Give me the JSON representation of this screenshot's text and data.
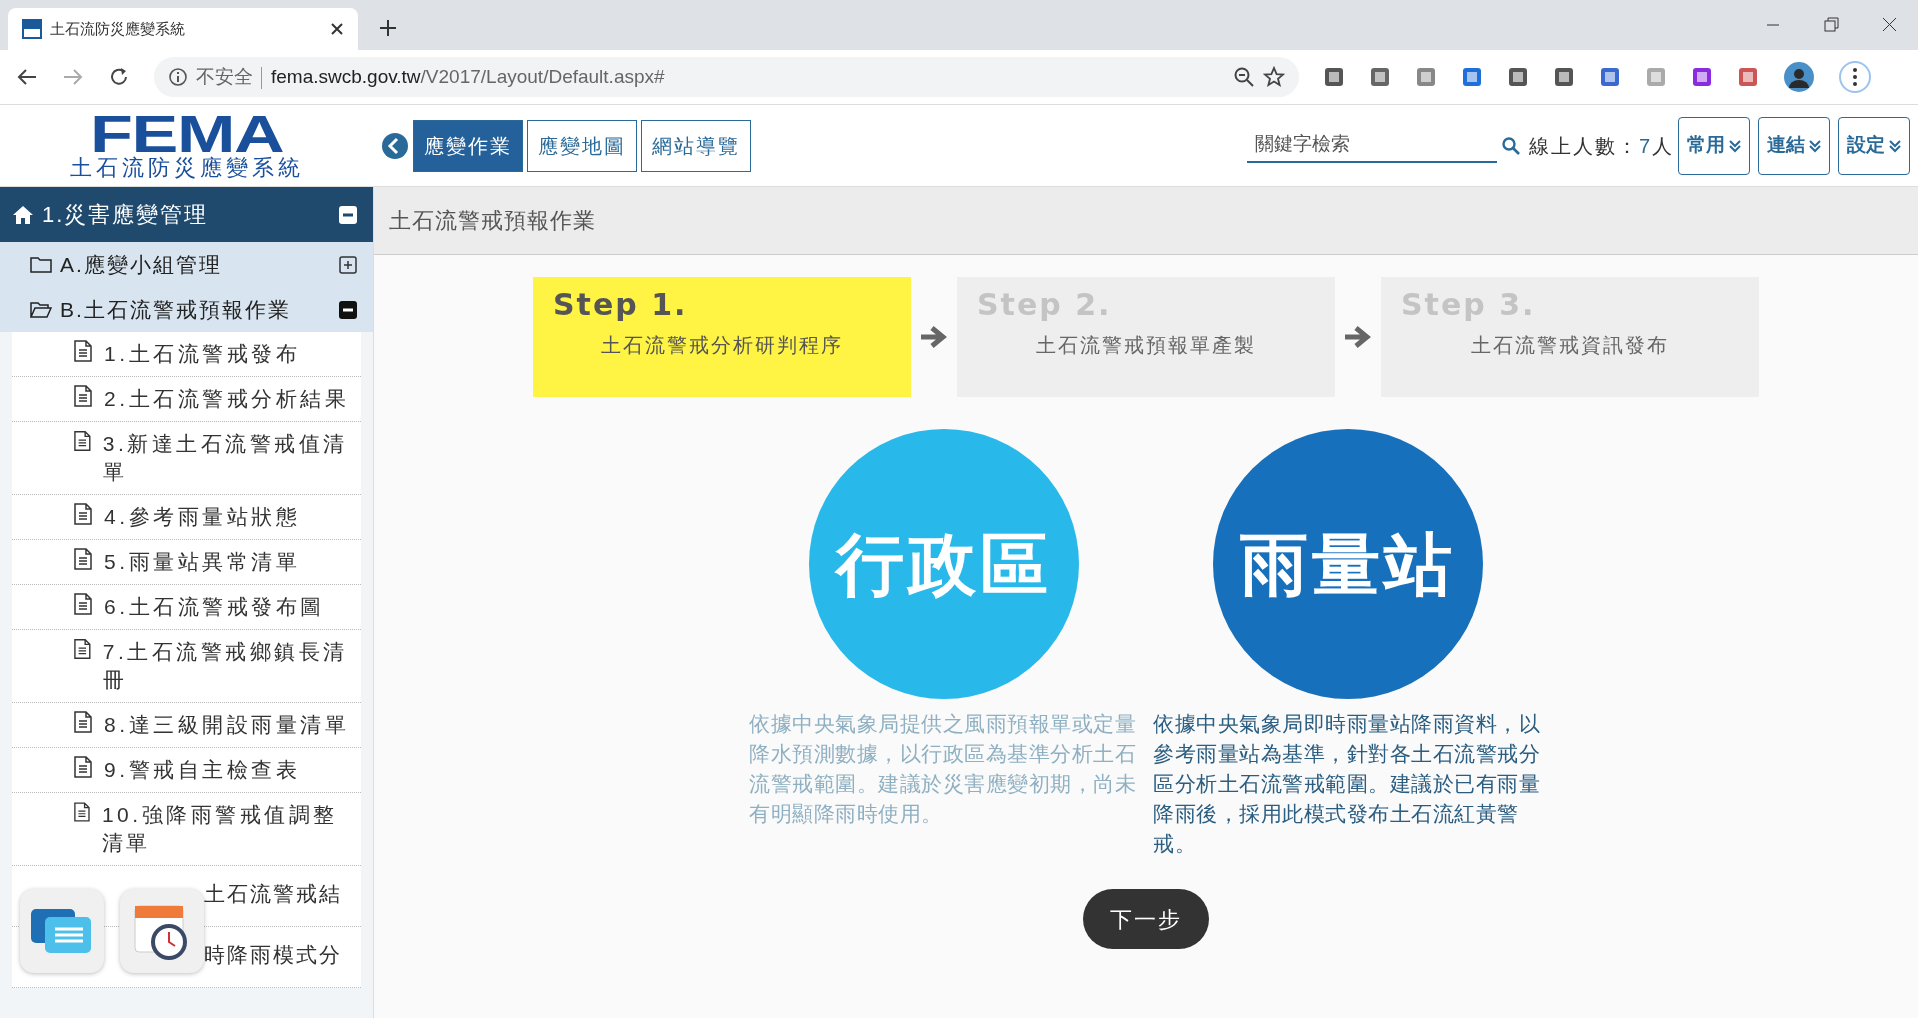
{
  "browser": {
    "tab_title": "土石流防災應變系統",
    "security": "不安全",
    "url_host": "fema.swcb.gov.tw",
    "url_path": "/V2017/Layout/Default.aspx#"
  },
  "header": {
    "logo": "FEMA",
    "subtitle": "土石流防災應變系統",
    "nav": [
      {
        "label": "應變作業",
        "selected": true
      },
      {
        "label": "應變地圖",
        "selected": false
      },
      {
        "label": "網站導覽",
        "selected": false
      }
    ],
    "search": {
      "placeholder": "關鍵字檢索"
    },
    "online_label": "線上人數：",
    "online_count": "7",
    "online_unit": "人",
    "menus": [
      "常用",
      "連結",
      "設定"
    ]
  },
  "sidebar": {
    "items": [
      {
        "label": "1.災害應變管理",
        "expanded": true,
        "children": [
          {
            "label": "A.應變小組管理",
            "expanded": false
          },
          {
            "label": "B.土石流警戒預報作業",
            "expanded": true,
            "children": [
              {
                "label": "1.土石流警戒發布"
              },
              {
                "label": "2.土石流警戒分析結果"
              },
              {
                "label": "3.新達土石流警戒值清單"
              },
              {
                "label": "4.參考雨量站狀態"
              },
              {
                "label": "5.雨量站異常清單"
              },
              {
                "label": "6.土石流警戒發布圖"
              },
              {
                "label": "7.土石流警戒鄉鎮長清冊"
              },
              {
                "label": "8.達三級開設雨量清單"
              },
              {
                "label": "9.警戒自主檢查表"
              },
              {
                "label": "10.強降雨警戒值調整清單"
              },
              {
                "label": "土石流警戒結",
                "covered": true
              },
              {
                "label": "時降雨模式分",
                "covered": true
              }
            ]
          }
        ]
      }
    ]
  },
  "page_title": "土石流警戒預報作業",
  "steps": [
    {
      "step": "Step 1.",
      "label": "土石流警戒分析研判程序",
      "selected": true
    },
    {
      "step": "Step 2.",
      "label": "土石流警戒預報單產製",
      "selected": false
    },
    {
      "step": "Step 3.",
      "label": "土石流警戒資訊發布",
      "selected": false
    }
  ],
  "options": [
    {
      "label": "行政區",
      "color": "#29b8ea",
      "selected": false,
      "description": "依據中央氣象局提供之風雨預報單或定量降水預測數據，以行政區為基準分析土石流警戒範圍。建議於災害應變初期，尚未有明顯降雨時使用。"
    },
    {
      "label": "雨量站",
      "color": "#1770bb",
      "selected": true,
      "description": "依據中央氣象局即時雨量站降雨資料，以參考雨量站為基準，針對各土石流警戒分區分析土石流警戒範圍。建議於已有雨量降雨後，採用此模式發布土石流紅黃警戒。"
    }
  ],
  "next_button": "下一步"
}
